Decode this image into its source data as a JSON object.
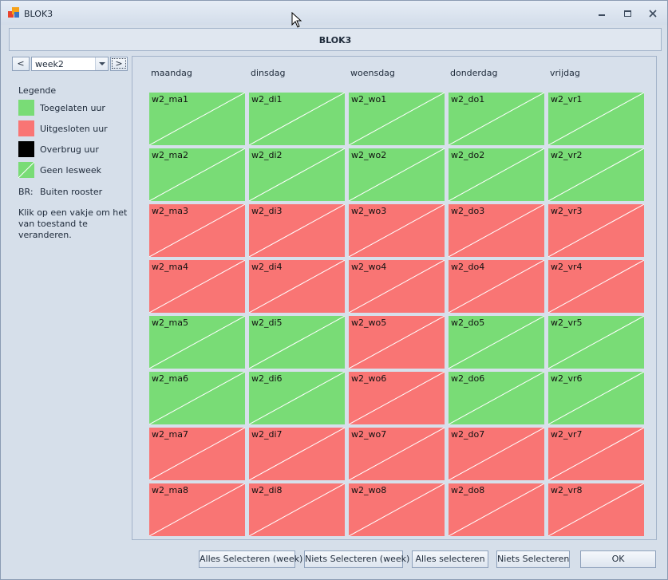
{
  "window": {
    "title": "BLOK3"
  },
  "header": {
    "title": "BLOK3"
  },
  "nav": {
    "prev_label": "<",
    "next_label": ">",
    "week_value": "week2"
  },
  "legend": {
    "title": "Legende",
    "items": [
      {
        "label": "Toegelaten uur",
        "color": "#79dc76"
      },
      {
        "label": "Uitgesloten uur",
        "color": "#f97574"
      },
      {
        "label": "Overbrug uur",
        "color": "#000000"
      },
      {
        "label": "Geen lesweek",
        "color": "#79dc76"
      }
    ],
    "br_key": "BR:",
    "br_label": "Buiten rooster",
    "help": "Klik op een vakje om het van toestand te veranderen."
  },
  "days": [
    "maandag",
    "dinsdag",
    "woensdag",
    "donderdag",
    "vrijdag"
  ],
  "grid": {
    "rows": [
      {
        "cells": [
          {
            "label": "w2_ma1",
            "state": "green"
          },
          {
            "label": "w2_di1",
            "state": "green"
          },
          {
            "label": "w2_wo1",
            "state": "green"
          },
          {
            "label": "w2_do1",
            "state": "green"
          },
          {
            "label": "w2_vr1",
            "state": "green"
          }
        ]
      },
      {
        "cells": [
          {
            "label": "w2_ma2",
            "state": "green"
          },
          {
            "label": "w2_di2",
            "state": "green"
          },
          {
            "label": "w2_wo2",
            "state": "green"
          },
          {
            "label": "w2_do2",
            "state": "green"
          },
          {
            "label": "w2_vr2",
            "state": "green"
          }
        ]
      },
      {
        "cells": [
          {
            "label": "w2_ma3",
            "state": "red"
          },
          {
            "label": "w2_di3",
            "state": "red"
          },
          {
            "label": "w2_wo3",
            "state": "red"
          },
          {
            "label": "w2_do3",
            "state": "red"
          },
          {
            "label": "w2_vr3",
            "state": "red"
          }
        ]
      },
      {
        "cells": [
          {
            "label": "w2_ma4",
            "state": "red"
          },
          {
            "label": "w2_di4",
            "state": "red"
          },
          {
            "label": "w2_wo4",
            "state": "red"
          },
          {
            "label": "w2_do4",
            "state": "red"
          },
          {
            "label": "w2_vr4",
            "state": "red"
          }
        ]
      },
      {
        "cells": [
          {
            "label": "w2_ma5",
            "state": "green"
          },
          {
            "label": "w2_di5",
            "state": "green"
          },
          {
            "label": "w2_wo5",
            "state": "red"
          },
          {
            "label": "w2_do5",
            "state": "green"
          },
          {
            "label": "w2_vr5",
            "state": "green"
          }
        ]
      },
      {
        "cells": [
          {
            "label": "w2_ma6",
            "state": "green"
          },
          {
            "label": "w2_di6",
            "state": "green"
          },
          {
            "label": "w2_wo6",
            "state": "red"
          },
          {
            "label": "w2_do6",
            "state": "green"
          },
          {
            "label": "w2_vr6",
            "state": "green"
          }
        ]
      },
      {
        "cells": [
          {
            "label": "w2_ma7",
            "state": "red"
          },
          {
            "label": "w2_di7",
            "state": "red"
          },
          {
            "label": "w2_wo7",
            "state": "red"
          },
          {
            "label": "w2_do7",
            "state": "red"
          },
          {
            "label": "w2_vr7",
            "state": "red"
          }
        ]
      },
      {
        "cells": [
          {
            "label": "w2_ma8",
            "state": "red"
          },
          {
            "label": "w2_di8",
            "state": "red"
          },
          {
            "label": "w2_wo8",
            "state": "red"
          },
          {
            "label": "w2_do8",
            "state": "red"
          },
          {
            "label": "w2_vr8",
            "state": "red"
          }
        ]
      }
    ]
  },
  "buttons": {
    "select_all_week": "Alles Selecteren (week)",
    "select_none_week": "Niets Selecteren (week)",
    "select_all": "Alles selecteren",
    "select_none": "Niets Selecteren",
    "ok": "OK"
  }
}
